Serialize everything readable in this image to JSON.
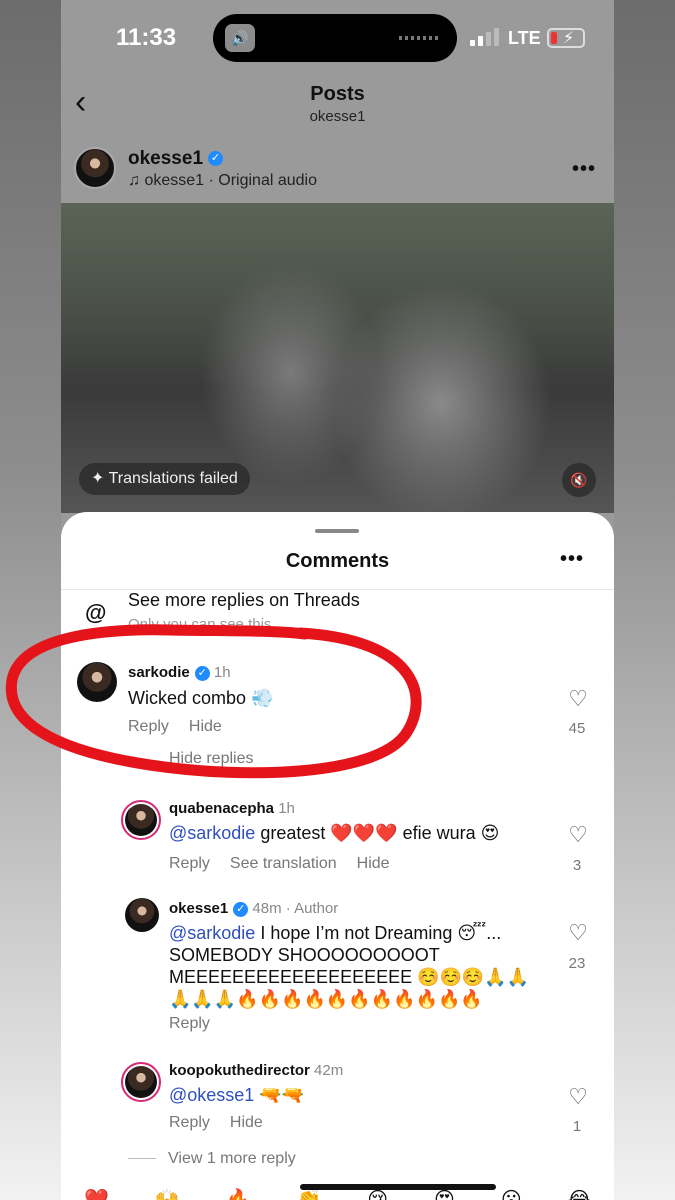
{
  "status": {
    "time": "11:33",
    "network": "LTE"
  },
  "header": {
    "title": "Posts",
    "subtitle": "okesse1"
  },
  "post": {
    "username": "okesse1",
    "audio": "okesse1 · Original audio",
    "translation_status": "Translations failed"
  },
  "comments": {
    "title": "Comments",
    "threads_label": "See more replies on Threads",
    "threads_sub": "Only you can see this",
    "hide_replies": "Hide replies",
    "view_more": "View 1 more reply",
    "items": [
      {
        "user": "sarkodie",
        "time": "1h",
        "text": "Wicked combo 💨",
        "actions": [
          "Reply",
          "Hide"
        ],
        "likes": "45"
      },
      {
        "user": "quabenacepha",
        "time": "1h",
        "mention": "@sarkodie",
        "text": " greatest ❤️❤️❤️ efie wura 😍",
        "actions": [
          "Reply",
          "See translation",
          "Hide"
        ],
        "likes": "3"
      },
      {
        "user": "okesse1",
        "time": "48m · Author",
        "mention": "@sarkodie",
        "text": " I hope I’m not Dreaming 😴... SOMEBODY SHOOOOOOOOOT MEEEEEEEEEEEEEEEEEEE ☺️☺️☺️🙏🙏🙏🙏🙏🔥🔥🔥🔥🔥🔥🔥🔥🔥🔥🔥",
        "actions": [
          "Reply"
        ],
        "likes": "23"
      },
      {
        "user": "koopokuthedirector",
        "time": "42m",
        "mention": "@okesse1",
        "text": " 🔫🔫",
        "actions": [
          "Reply",
          "Hide"
        ],
        "likes": "1"
      }
    ]
  },
  "icons": {
    "back": "chevron-left-icon",
    "more": "more-horizontal-icon",
    "heart": "heart-icon",
    "threads": "threads-icon",
    "mute": "mute-icon",
    "sparkle": "sparkle-icon"
  },
  "colors": {
    "annotation": "#e5131a",
    "verified": "#1f8bff",
    "mention": "#2f4fbf"
  }
}
